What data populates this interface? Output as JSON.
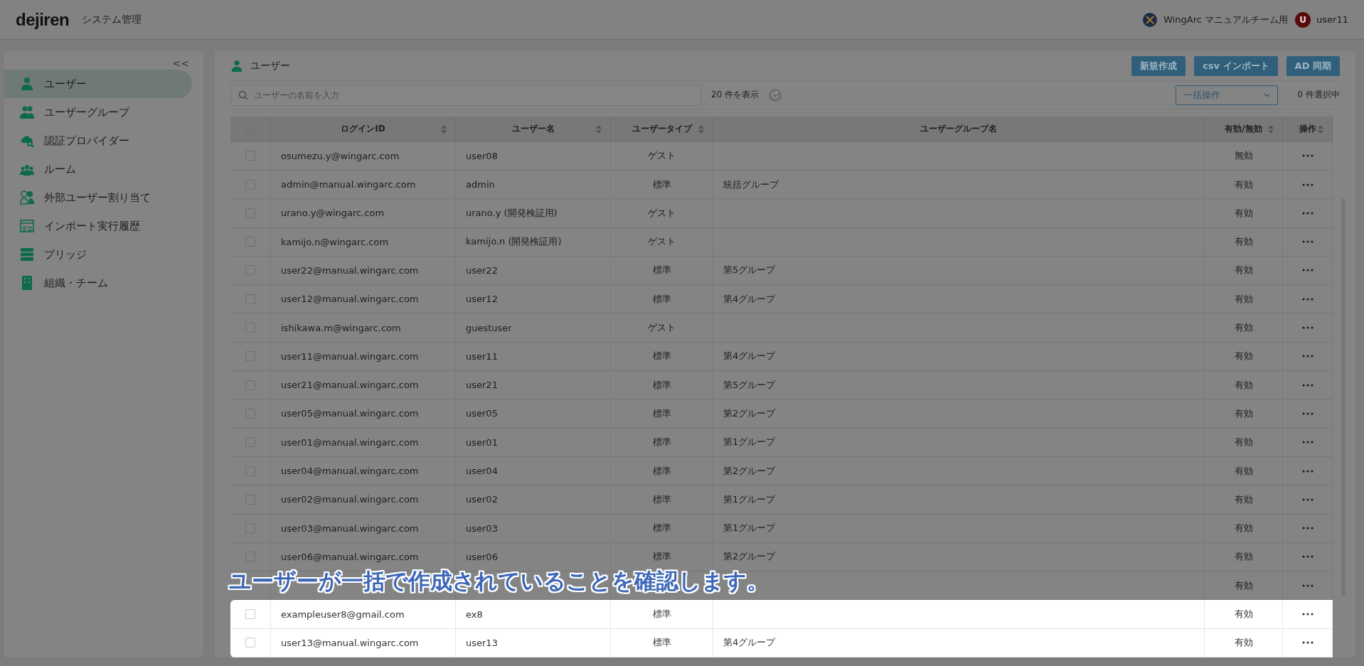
{
  "header": {
    "logo": "dejiren",
    "app_title": "システム管理",
    "team": "WingArc マニュアルチーム用",
    "avatar_letter": "U",
    "user": "user11"
  },
  "sidebar": {
    "collapse": "<<",
    "items": [
      {
        "label": "ユーザー",
        "selected": true
      },
      {
        "label": "ユーザーグループ",
        "selected": false
      },
      {
        "label": "認証プロバイダー",
        "selected": false
      },
      {
        "label": "ルーム",
        "selected": false
      },
      {
        "label": "外部ユーザー割り当て",
        "selected": false
      },
      {
        "label": "インポート実行履歴",
        "selected": false
      },
      {
        "label": "ブリッジ",
        "selected": false
      },
      {
        "label": "組織・チーム",
        "selected": false
      }
    ]
  },
  "page": {
    "title": "ユーザー",
    "buttons": [
      "新規作成",
      "csv インポート",
      "AD 同期"
    ],
    "search": {
      "placeholder": "ユーザーの名前を入力"
    },
    "count": "20 件を表示",
    "bulk_action": "一括操作",
    "selected_count": "0 件選択中"
  },
  "table": {
    "header_checked": false,
    "columns": [
      "ログインID",
      "ユーザー名",
      "ユーザータイプ",
      "ユーザーグループ名",
      "有効/無効",
      "操作"
    ],
    "rows": [
      {
        "checked": false,
        "highlighted": false,
        "login": "osumezu.y@wingarc.com",
        "name": "user08",
        "type": "ゲスト",
        "status": "無効"
      },
      {
        "checked": false,
        "highlighted": false,
        "login": "admin@manual.wingarc.com",
        "name": "admin",
        "type": "標準",
        "group": "統括グループ",
        "status": "有効"
      },
      {
        "checked": false,
        "highlighted": false,
        "login": "urano.y@wingarc.com",
        "name": "urano.y (開発検証用)",
        "type": "ゲスト",
        "status": "有効"
      },
      {
        "checked": false,
        "highlighted": false,
        "login": "kamijo.n@wingarc.com",
        "name": "kamijo.n (開発検証用)",
        "type": "ゲスト",
        "status": "有効"
      },
      {
        "checked": false,
        "highlighted": false,
        "login": "user22@manual.wingarc.com",
        "name": "user22",
        "type": "標準",
        "group": "第5グループ",
        "status": "有効"
      },
      {
        "checked": false,
        "highlighted": false,
        "login": "user12@manual.wingarc.com",
        "name": "user12",
        "type": "標準",
        "group": "第4グループ",
        "status": "有効"
      },
      {
        "checked": false,
        "highlighted": false,
        "login": "ishikawa.m@wingarc.com",
        "name": "guestuser",
        "type": "ゲスト",
        "status": "有効"
      },
      {
        "checked": false,
        "highlighted": false,
        "login": "user11@manual.wingarc.com",
        "name": "user11",
        "type": "標準",
        "group": "第4グループ",
        "status": "有効"
      },
      {
        "checked": false,
        "highlighted": false,
        "login": "user21@manual.wingarc.com",
        "name": "user21",
        "type": "標準",
        "group": "第5グループ",
        "status": "有効"
      },
      {
        "checked": false,
        "highlighted": false,
        "login": "user05@manual.wingarc.com",
        "name": "user05",
        "type": "標準",
        "group": "第2グループ",
        "status": "有効"
      },
      {
        "checked": false,
        "highlighted": false,
        "login": "user01@manual.wingarc.com",
        "name": "user01",
        "type": "標準",
        "group": "第1グループ",
        "status": "有効"
      },
      {
        "checked": false,
        "highlighted": false,
        "login": "user04@manual.wingarc.com",
        "name": "user04",
        "type": "標準",
        "group": "第2グループ",
        "status": "有効"
      },
      {
        "checked": false,
        "highlighted": false,
        "login": "user02@manual.wingarc.com",
        "name": "user02",
        "type": "標準",
        "group": "第1グループ",
        "status": "有効"
      },
      {
        "checked": false,
        "highlighted": false,
        "login": "user03@manual.wingarc.com",
        "name": "user03",
        "type": "標準",
        "group": "第1グループ",
        "status": "有効"
      },
      {
        "checked": false,
        "highlighted": false,
        "login": "user06@manual.wingarc.com",
        "name": "user06",
        "type": "標準",
        "group": "第2グループ",
        "status": "有効"
      },
      {
        "highlighted": false,
        "status": "有効"
      },
      {
        "checked": false,
        "highlighted": true,
        "login": "exampleuser8@gmail.com",
        "name": "ex8",
        "type": "標準",
        "status": "有効"
      },
      {
        "checked": false,
        "highlighted": true,
        "login": "user13@manual.wingarc.com",
        "name": "user13",
        "type": "標準",
        "group": "第4グループ",
        "status": "有効"
      }
    ]
  },
  "caption": "ユーザーが一括で作成されていることを確認します。"
}
